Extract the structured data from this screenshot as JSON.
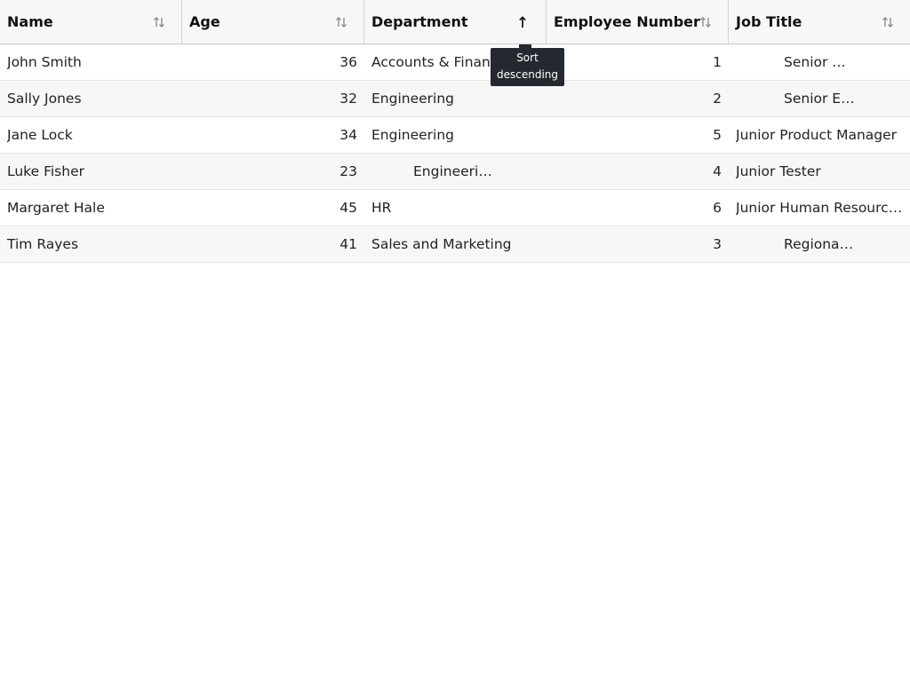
{
  "table": {
    "columns": [
      {
        "label": "Name",
        "sort_icon": "sort-both-icon"
      },
      {
        "label": "Age",
        "sort_icon": "sort-both-icon"
      },
      {
        "label": "Department",
        "sort_icon": "sort-ascending-icon"
      },
      {
        "label": "Employee Number",
        "sort_icon": "sort-both-icon"
      },
      {
        "label": "Job Title",
        "sort_icon": "sort-both-icon"
      }
    ],
    "rows": [
      {
        "name": "John Smith",
        "age": "36",
        "department": "Accounts & Finance",
        "employee_number": "1",
        "job_title": "Senior Accountant"
      },
      {
        "name": "Sally Jones",
        "age": "32",
        "department": "Engineering",
        "employee_number": "2",
        "job_title": "Senior Engineer"
      },
      {
        "name": "Jane Lock",
        "age": "34",
        "department": "Engineering",
        "employee_number": "5",
        "job_title": "Junior Product Manager"
      },
      {
        "name": "Luke Fisher",
        "age": "23",
        "department": "Engineering Support",
        "employee_number": "4",
        "job_title": "Junior Tester"
      },
      {
        "name": "Margaret Hale",
        "age": "45",
        "department": "HR",
        "employee_number": "6",
        "job_title": "Junior Human Resources Officer"
      },
      {
        "name": "Tim Rayes",
        "age": "41",
        "department": "Sales and Marketing",
        "employee_number": "3",
        "job_title": "Regional Sales Manager"
      }
    ]
  },
  "tooltip": {
    "line1": "Sort",
    "line2": "descending"
  },
  "colors": {
    "header_bg": "#f7f7f7",
    "stripe_bg": "#f6f7f7",
    "tooltip_bg": "#24292f"
  }
}
